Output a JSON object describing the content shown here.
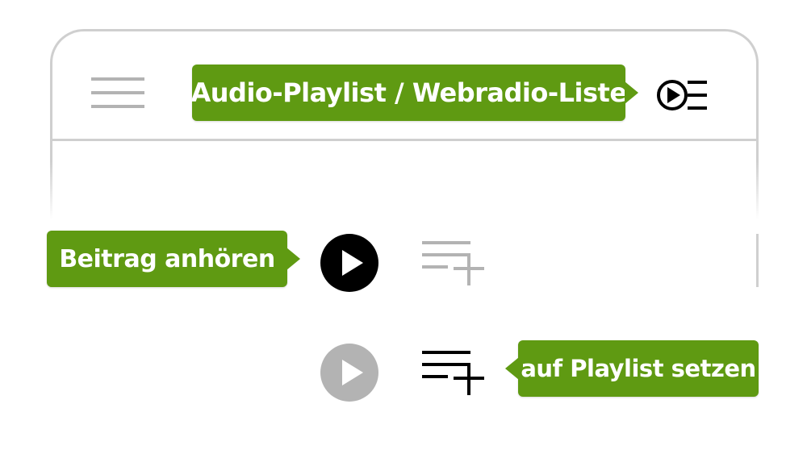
{
  "header": {
    "menu_icon": "hamburger-icon",
    "playlist_icon": "playlist-play-icon",
    "playlist_tooltip": "Audio-Playlist / Webradio-Liste"
  },
  "rows": [
    {
      "play_icon": "play-icon",
      "play_state": "active",
      "add_icon": "playlist-add-icon",
      "add_state": "inactive",
      "tooltip": "Beitrag anhören"
    },
    {
      "play_icon": "play-icon",
      "play_state": "inactive",
      "add_icon": "playlist-add-icon",
      "add_state": "active",
      "tooltip": "auf Playlist setzen"
    }
  ],
  "colors": {
    "accent_green": "#5f9a12",
    "active_black": "#000000",
    "inactive_gray": "#b3b3b3",
    "frame_gray": "#cfcfcf"
  }
}
